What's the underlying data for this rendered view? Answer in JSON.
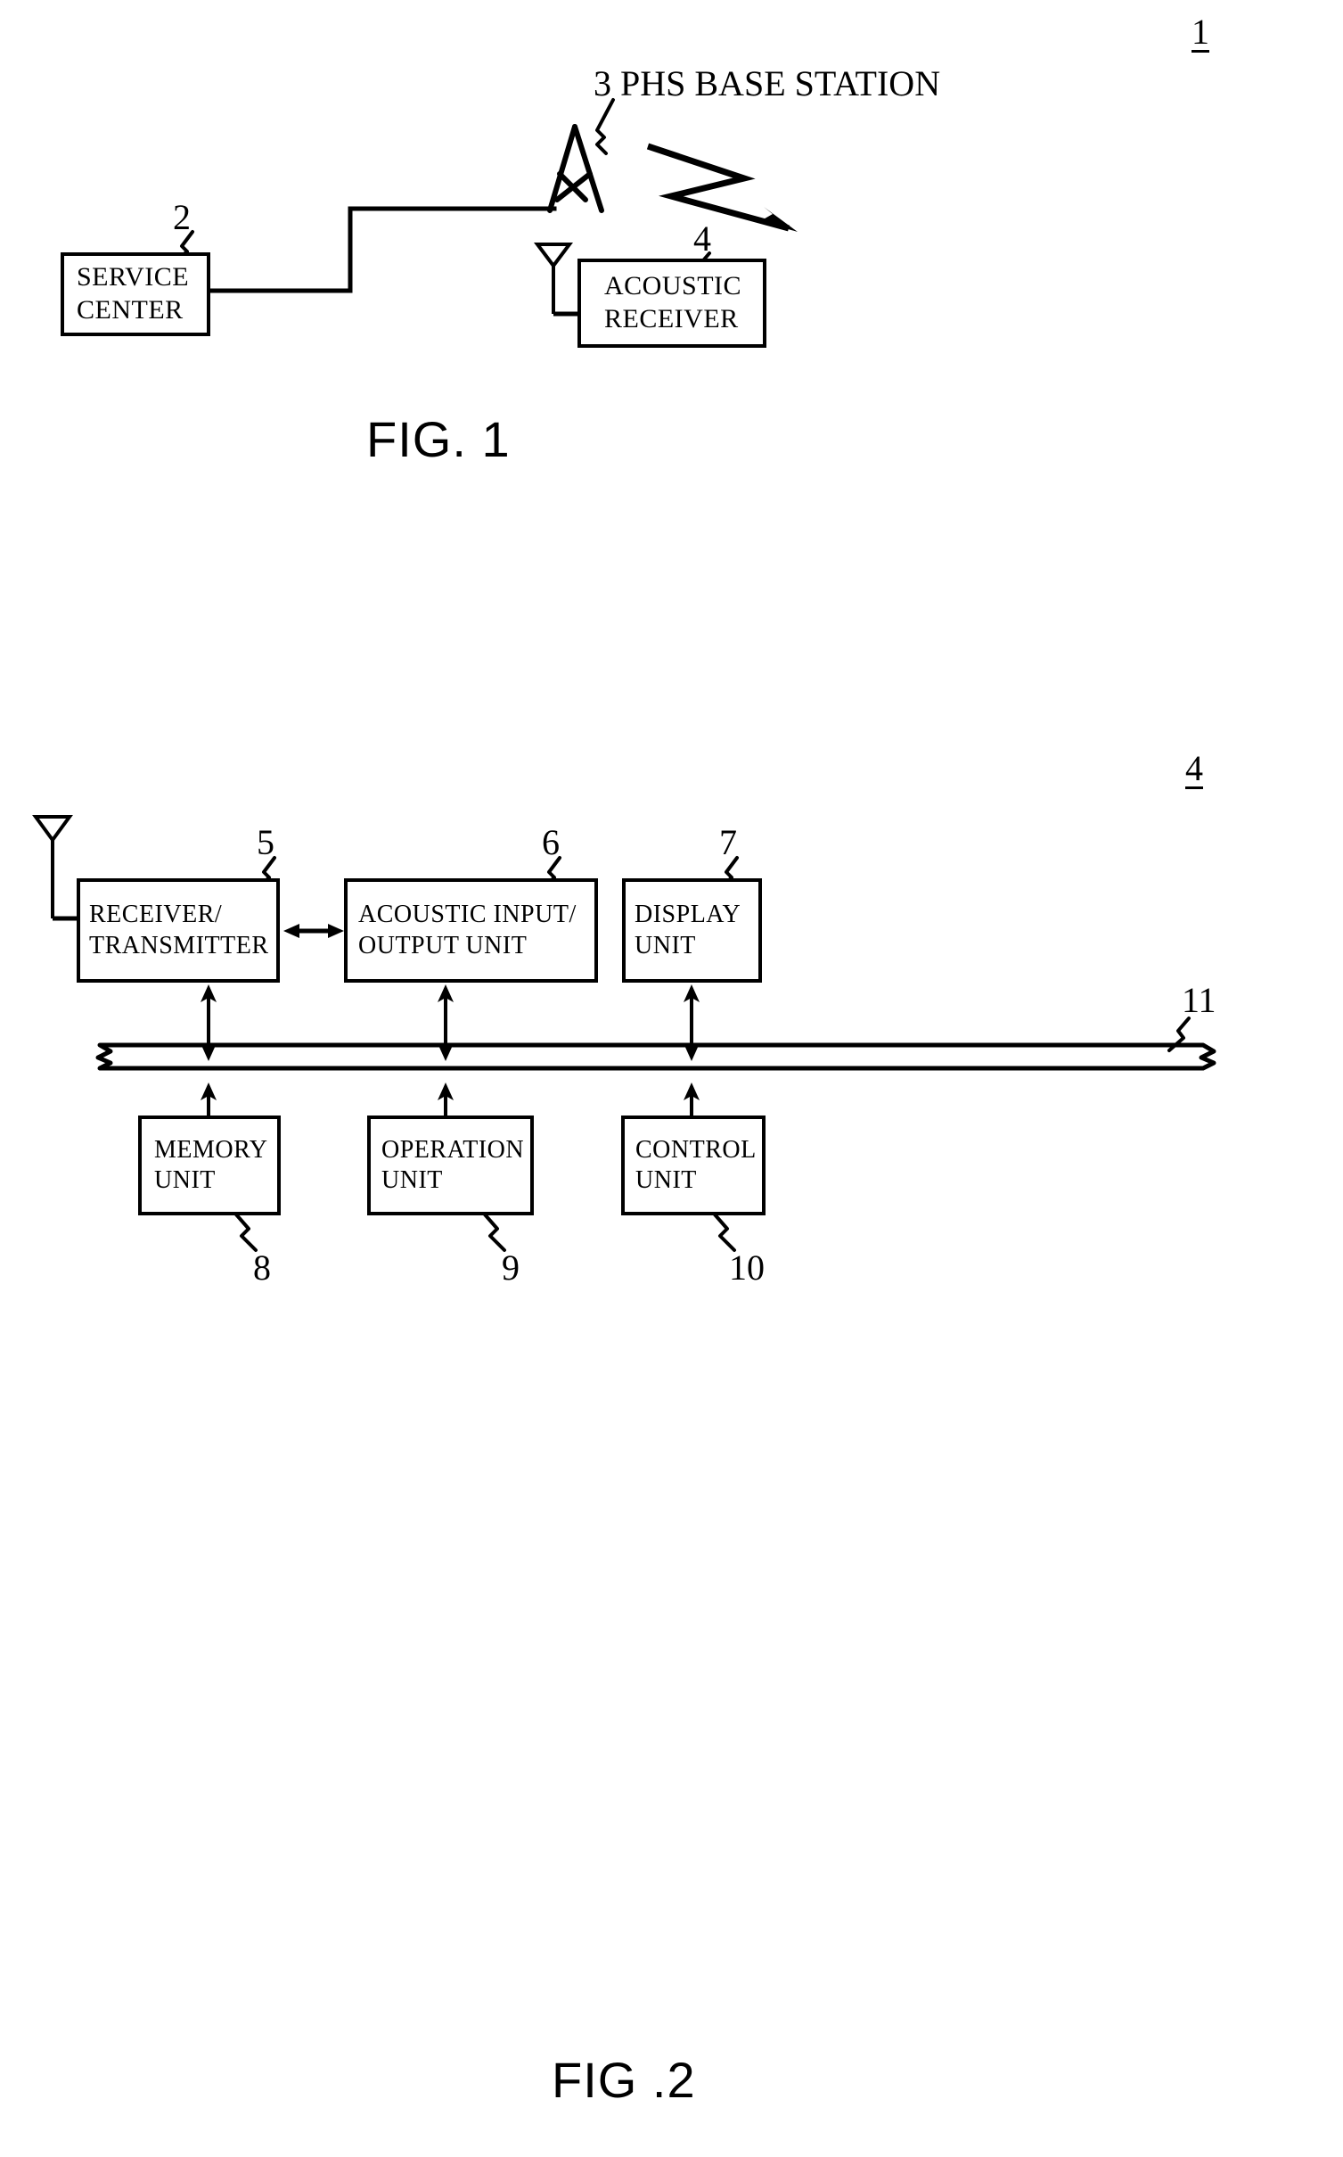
{
  "figures": [
    {
      "id": "fig1",
      "caption": "FIG. 1",
      "system_ref": "1",
      "base_station_label": "3 PHS BASE STATION",
      "blocks": [
        {
          "id": "service-center",
          "lines": [
            "SERVICE",
            "CENTER"
          ],
          "ref": "2"
        },
        {
          "id": "acoustic-receiver",
          "lines": [
            "ACOUSTIC",
            "RECEIVER"
          ],
          "ref": "4"
        }
      ],
      "connections": [
        {
          "from": "service-center",
          "to": "phs-base-station",
          "type": "wired-stepped-line"
        },
        {
          "from": "phs-base-station",
          "to": "acoustic-receiver",
          "type": "wireless-zigzag-arrow"
        }
      ]
    },
    {
      "id": "fig2",
      "caption": "FIG .2",
      "system_ref": "4",
      "bus_ref": "11",
      "blocks_top": [
        {
          "id": "receiver-transmitter",
          "lines": [
            "RECEIVER/",
            "TRANSMITTER"
          ],
          "ref": "5"
        },
        {
          "id": "acoustic-io-unit",
          "lines": [
            "ACOUSTIC INPUT/",
            "OUTPUT UNIT"
          ],
          "ref": "6"
        },
        {
          "id": "display-unit",
          "lines": [
            "DISPLAY",
            "UNIT"
          ],
          "ref": "7"
        }
      ],
      "blocks_bottom": [
        {
          "id": "memory-unit",
          "lines": [
            "MEMORY",
            "UNIT"
          ],
          "ref": "8"
        },
        {
          "id": "operation-unit",
          "lines": [
            "OPERATION",
            "UNIT"
          ],
          "ref": "9"
        },
        {
          "id": "control-unit",
          "lines": [
            "CONTROL",
            "UNIT"
          ],
          "ref": "10"
        }
      ]
    }
  ],
  "colors": {
    "ink": "#000000",
    "paper": "#ffffff"
  }
}
